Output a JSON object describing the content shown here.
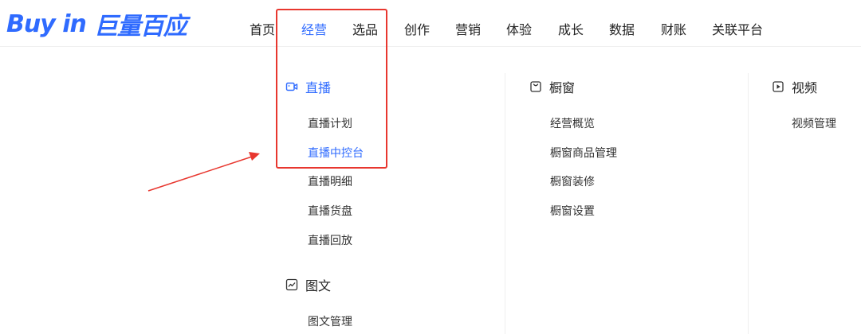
{
  "brand": {
    "logo_en": "Buy in",
    "logo_cn": "巨量百应"
  },
  "nav": {
    "items": [
      "首页",
      "经营",
      "选品",
      "创作",
      "营销",
      "体验",
      "成长",
      "数据",
      "财账",
      "关联平台"
    ],
    "active": "经营"
  },
  "menu": {
    "live": {
      "title": "直播",
      "icon": "live-camera-icon",
      "items": [
        "直播计划",
        "直播中控台",
        "直播明细",
        "直播货盘",
        "直播回放"
      ],
      "active_item": "直播中控台"
    },
    "graphic": {
      "title": "图文",
      "icon": "image-text-icon",
      "items": [
        "图文管理"
      ]
    },
    "showcase": {
      "title": "橱窗",
      "icon": "showcase-bag-icon",
      "items": [
        "经营概览",
        "橱窗商品管理",
        "橱窗装修",
        "橱窗设置"
      ]
    },
    "video": {
      "title": "视频",
      "icon": "play-icon",
      "items": [
        "视频管理"
      ]
    }
  },
  "colors": {
    "brand_blue": "#2f6bff",
    "annotation_red": "#e8372f"
  }
}
